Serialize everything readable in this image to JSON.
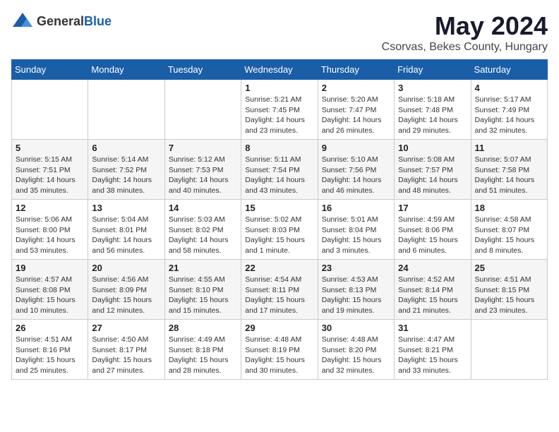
{
  "logo": {
    "text_general": "General",
    "text_blue": "Blue"
  },
  "header": {
    "month_year": "May 2024",
    "location": "Csorvas, Bekes County, Hungary"
  },
  "weekdays": [
    "Sunday",
    "Monday",
    "Tuesday",
    "Wednesday",
    "Thursday",
    "Friday",
    "Saturday"
  ],
  "weeks": [
    [
      {
        "day": "",
        "sunrise": "",
        "sunset": "",
        "daylight": ""
      },
      {
        "day": "",
        "sunrise": "",
        "sunset": "",
        "daylight": ""
      },
      {
        "day": "",
        "sunrise": "",
        "sunset": "",
        "daylight": ""
      },
      {
        "day": "1",
        "sunrise": "Sunrise: 5:21 AM",
        "sunset": "Sunset: 7:45 PM",
        "daylight": "Daylight: 14 hours and 23 minutes."
      },
      {
        "day": "2",
        "sunrise": "Sunrise: 5:20 AM",
        "sunset": "Sunset: 7:47 PM",
        "daylight": "Daylight: 14 hours and 26 minutes."
      },
      {
        "day": "3",
        "sunrise": "Sunrise: 5:18 AM",
        "sunset": "Sunset: 7:48 PM",
        "daylight": "Daylight: 14 hours and 29 minutes."
      },
      {
        "day": "4",
        "sunrise": "Sunrise: 5:17 AM",
        "sunset": "Sunset: 7:49 PM",
        "daylight": "Daylight: 14 hours and 32 minutes."
      }
    ],
    [
      {
        "day": "5",
        "sunrise": "Sunrise: 5:15 AM",
        "sunset": "Sunset: 7:51 PM",
        "daylight": "Daylight: 14 hours and 35 minutes."
      },
      {
        "day": "6",
        "sunrise": "Sunrise: 5:14 AM",
        "sunset": "Sunset: 7:52 PM",
        "daylight": "Daylight: 14 hours and 38 minutes."
      },
      {
        "day": "7",
        "sunrise": "Sunrise: 5:12 AM",
        "sunset": "Sunset: 7:53 PM",
        "daylight": "Daylight: 14 hours and 40 minutes."
      },
      {
        "day": "8",
        "sunrise": "Sunrise: 5:11 AM",
        "sunset": "Sunset: 7:54 PM",
        "daylight": "Daylight: 14 hours and 43 minutes."
      },
      {
        "day": "9",
        "sunrise": "Sunrise: 5:10 AM",
        "sunset": "Sunset: 7:56 PM",
        "daylight": "Daylight: 14 hours and 46 minutes."
      },
      {
        "day": "10",
        "sunrise": "Sunrise: 5:08 AM",
        "sunset": "Sunset: 7:57 PM",
        "daylight": "Daylight: 14 hours and 48 minutes."
      },
      {
        "day": "11",
        "sunrise": "Sunrise: 5:07 AM",
        "sunset": "Sunset: 7:58 PM",
        "daylight": "Daylight: 14 hours and 51 minutes."
      }
    ],
    [
      {
        "day": "12",
        "sunrise": "Sunrise: 5:06 AM",
        "sunset": "Sunset: 8:00 PM",
        "daylight": "Daylight: 14 hours and 53 minutes."
      },
      {
        "day": "13",
        "sunrise": "Sunrise: 5:04 AM",
        "sunset": "Sunset: 8:01 PM",
        "daylight": "Daylight: 14 hours and 56 minutes."
      },
      {
        "day": "14",
        "sunrise": "Sunrise: 5:03 AM",
        "sunset": "Sunset: 8:02 PM",
        "daylight": "Daylight: 14 hours and 58 minutes."
      },
      {
        "day": "15",
        "sunrise": "Sunrise: 5:02 AM",
        "sunset": "Sunset: 8:03 PM",
        "daylight": "Daylight: 15 hours and 1 minute."
      },
      {
        "day": "16",
        "sunrise": "Sunrise: 5:01 AM",
        "sunset": "Sunset: 8:04 PM",
        "daylight": "Daylight: 15 hours and 3 minutes."
      },
      {
        "day": "17",
        "sunrise": "Sunrise: 4:59 AM",
        "sunset": "Sunset: 8:06 PM",
        "daylight": "Daylight: 15 hours and 6 minutes."
      },
      {
        "day": "18",
        "sunrise": "Sunrise: 4:58 AM",
        "sunset": "Sunset: 8:07 PM",
        "daylight": "Daylight: 15 hours and 8 minutes."
      }
    ],
    [
      {
        "day": "19",
        "sunrise": "Sunrise: 4:57 AM",
        "sunset": "Sunset: 8:08 PM",
        "daylight": "Daylight: 15 hours and 10 minutes."
      },
      {
        "day": "20",
        "sunrise": "Sunrise: 4:56 AM",
        "sunset": "Sunset: 8:09 PM",
        "daylight": "Daylight: 15 hours and 12 minutes."
      },
      {
        "day": "21",
        "sunrise": "Sunrise: 4:55 AM",
        "sunset": "Sunset: 8:10 PM",
        "daylight": "Daylight: 15 hours and 15 minutes."
      },
      {
        "day": "22",
        "sunrise": "Sunrise: 4:54 AM",
        "sunset": "Sunset: 8:11 PM",
        "daylight": "Daylight: 15 hours and 17 minutes."
      },
      {
        "day": "23",
        "sunrise": "Sunrise: 4:53 AM",
        "sunset": "Sunset: 8:13 PM",
        "daylight": "Daylight: 15 hours and 19 minutes."
      },
      {
        "day": "24",
        "sunrise": "Sunrise: 4:52 AM",
        "sunset": "Sunset: 8:14 PM",
        "daylight": "Daylight: 15 hours and 21 minutes."
      },
      {
        "day": "25",
        "sunrise": "Sunrise: 4:51 AM",
        "sunset": "Sunset: 8:15 PM",
        "daylight": "Daylight: 15 hours and 23 minutes."
      }
    ],
    [
      {
        "day": "26",
        "sunrise": "Sunrise: 4:51 AM",
        "sunset": "Sunset: 8:16 PM",
        "daylight": "Daylight: 15 hours and 25 minutes."
      },
      {
        "day": "27",
        "sunrise": "Sunrise: 4:50 AM",
        "sunset": "Sunset: 8:17 PM",
        "daylight": "Daylight: 15 hours and 27 minutes."
      },
      {
        "day": "28",
        "sunrise": "Sunrise: 4:49 AM",
        "sunset": "Sunset: 8:18 PM",
        "daylight": "Daylight: 15 hours and 28 minutes."
      },
      {
        "day": "29",
        "sunrise": "Sunrise: 4:48 AM",
        "sunset": "Sunset: 8:19 PM",
        "daylight": "Daylight: 15 hours and 30 minutes."
      },
      {
        "day": "30",
        "sunrise": "Sunrise: 4:48 AM",
        "sunset": "Sunset: 8:20 PM",
        "daylight": "Daylight: 15 hours and 32 minutes."
      },
      {
        "day": "31",
        "sunrise": "Sunrise: 4:47 AM",
        "sunset": "Sunset: 8:21 PM",
        "daylight": "Daylight: 15 hours and 33 minutes."
      },
      {
        "day": "",
        "sunrise": "",
        "sunset": "",
        "daylight": ""
      }
    ]
  ]
}
